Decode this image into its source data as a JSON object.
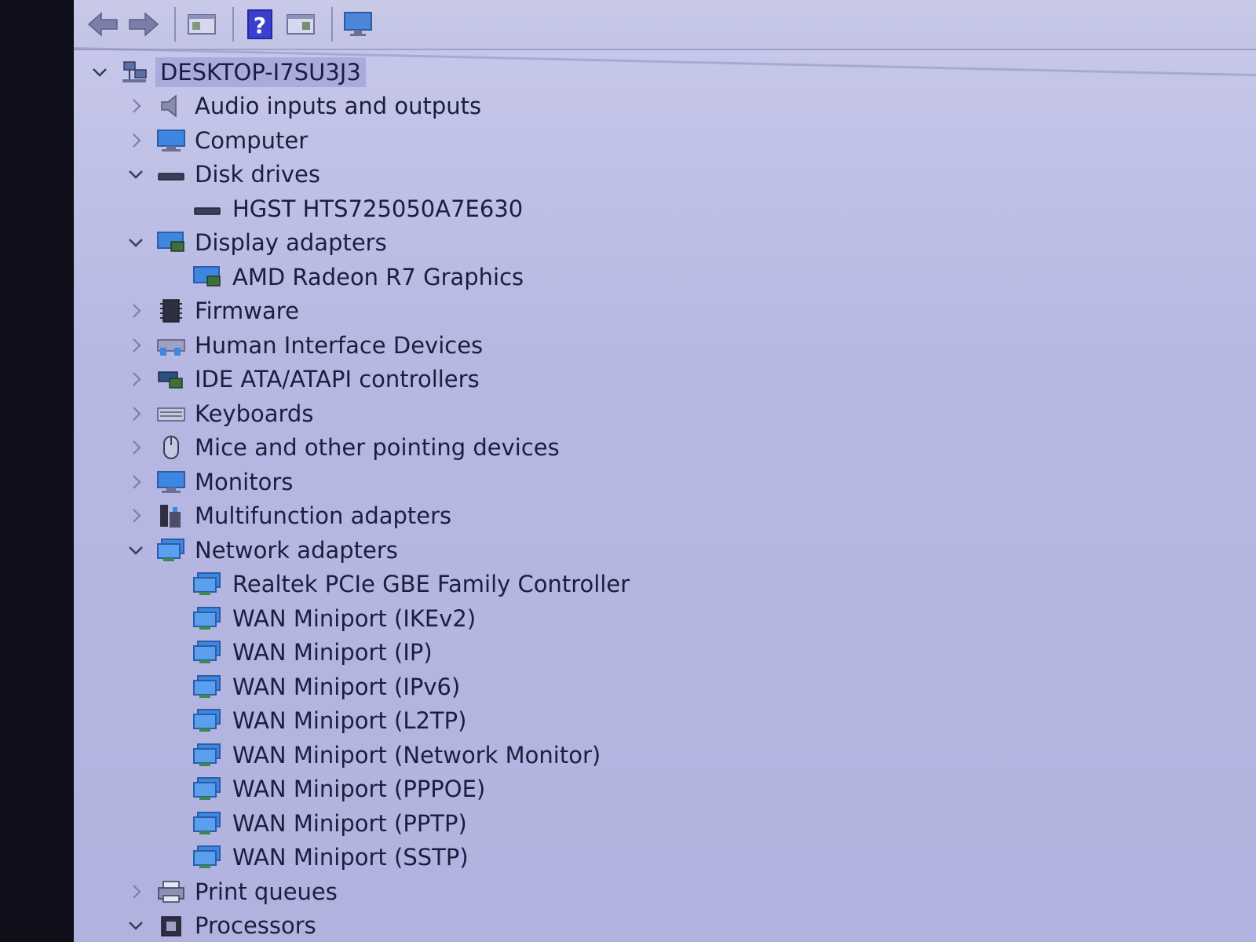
{
  "tree": {
    "root": {
      "label": "DESKTOP-I7SU3J3",
      "icon": "computer-network-icon",
      "expanded": true
    },
    "categories": [
      {
        "label": "Audio inputs and outputs",
        "icon": "speaker-icon",
        "expanded": false,
        "children": []
      },
      {
        "label": "Computer",
        "icon": "monitor-icon",
        "expanded": false,
        "children": []
      },
      {
        "label": "Disk drives",
        "icon": "disk-drive-icon",
        "expanded": true,
        "children": [
          "HGST HTS725050A7E630"
        ]
      },
      {
        "label": "Display adapters",
        "icon": "display-adapter-icon",
        "expanded": true,
        "children": [
          "AMD Radeon R7 Graphics"
        ]
      },
      {
        "label": "Firmware",
        "icon": "chip-icon",
        "expanded": false,
        "children": []
      },
      {
        "label": "Human Interface Devices",
        "icon": "hid-icon",
        "expanded": false,
        "children": []
      },
      {
        "label": "IDE ATA/ATAPI controllers",
        "icon": "controller-icon",
        "expanded": false,
        "children": []
      },
      {
        "label": "Keyboards",
        "icon": "keyboard-icon",
        "expanded": false,
        "children": []
      },
      {
        "label": "Mice and other pointing devices",
        "icon": "mouse-icon",
        "expanded": false,
        "children": []
      },
      {
        "label": "Monitors",
        "icon": "monitor-icon",
        "expanded": false,
        "children": []
      },
      {
        "label": "Multifunction adapters",
        "icon": "multifunction-icon",
        "expanded": false,
        "children": []
      },
      {
        "label": "Network adapters",
        "icon": "network-adapter-icon",
        "expanded": true,
        "children": [
          "Realtek PCIe GBE Family Controller",
          "WAN Miniport (IKEv2)",
          "WAN Miniport (IP)",
          "WAN Miniport (IPv6)",
          "WAN Miniport (L2TP)",
          "WAN Miniport (Network Monitor)",
          "WAN Miniport (PPPOE)",
          "WAN Miniport (PPTP)",
          "WAN Miniport (SSTP)"
        ]
      },
      {
        "label": "Print queues",
        "icon": "printer-icon",
        "expanded": false,
        "children": []
      },
      {
        "label": "Processors",
        "icon": "processor-icon",
        "expanded": true,
        "children": []
      }
    ]
  },
  "toolbar": {
    "buttons": [
      "back-arrow-icon",
      "forward-arrow-icon",
      "properties-icon",
      "help-icon",
      "update-driver-icon",
      "scan-monitor-icon"
    ]
  },
  "colors": {
    "window_bg": "#b6b7e2",
    "text": "#1c1e3e",
    "selection": "#a9abdd"
  }
}
